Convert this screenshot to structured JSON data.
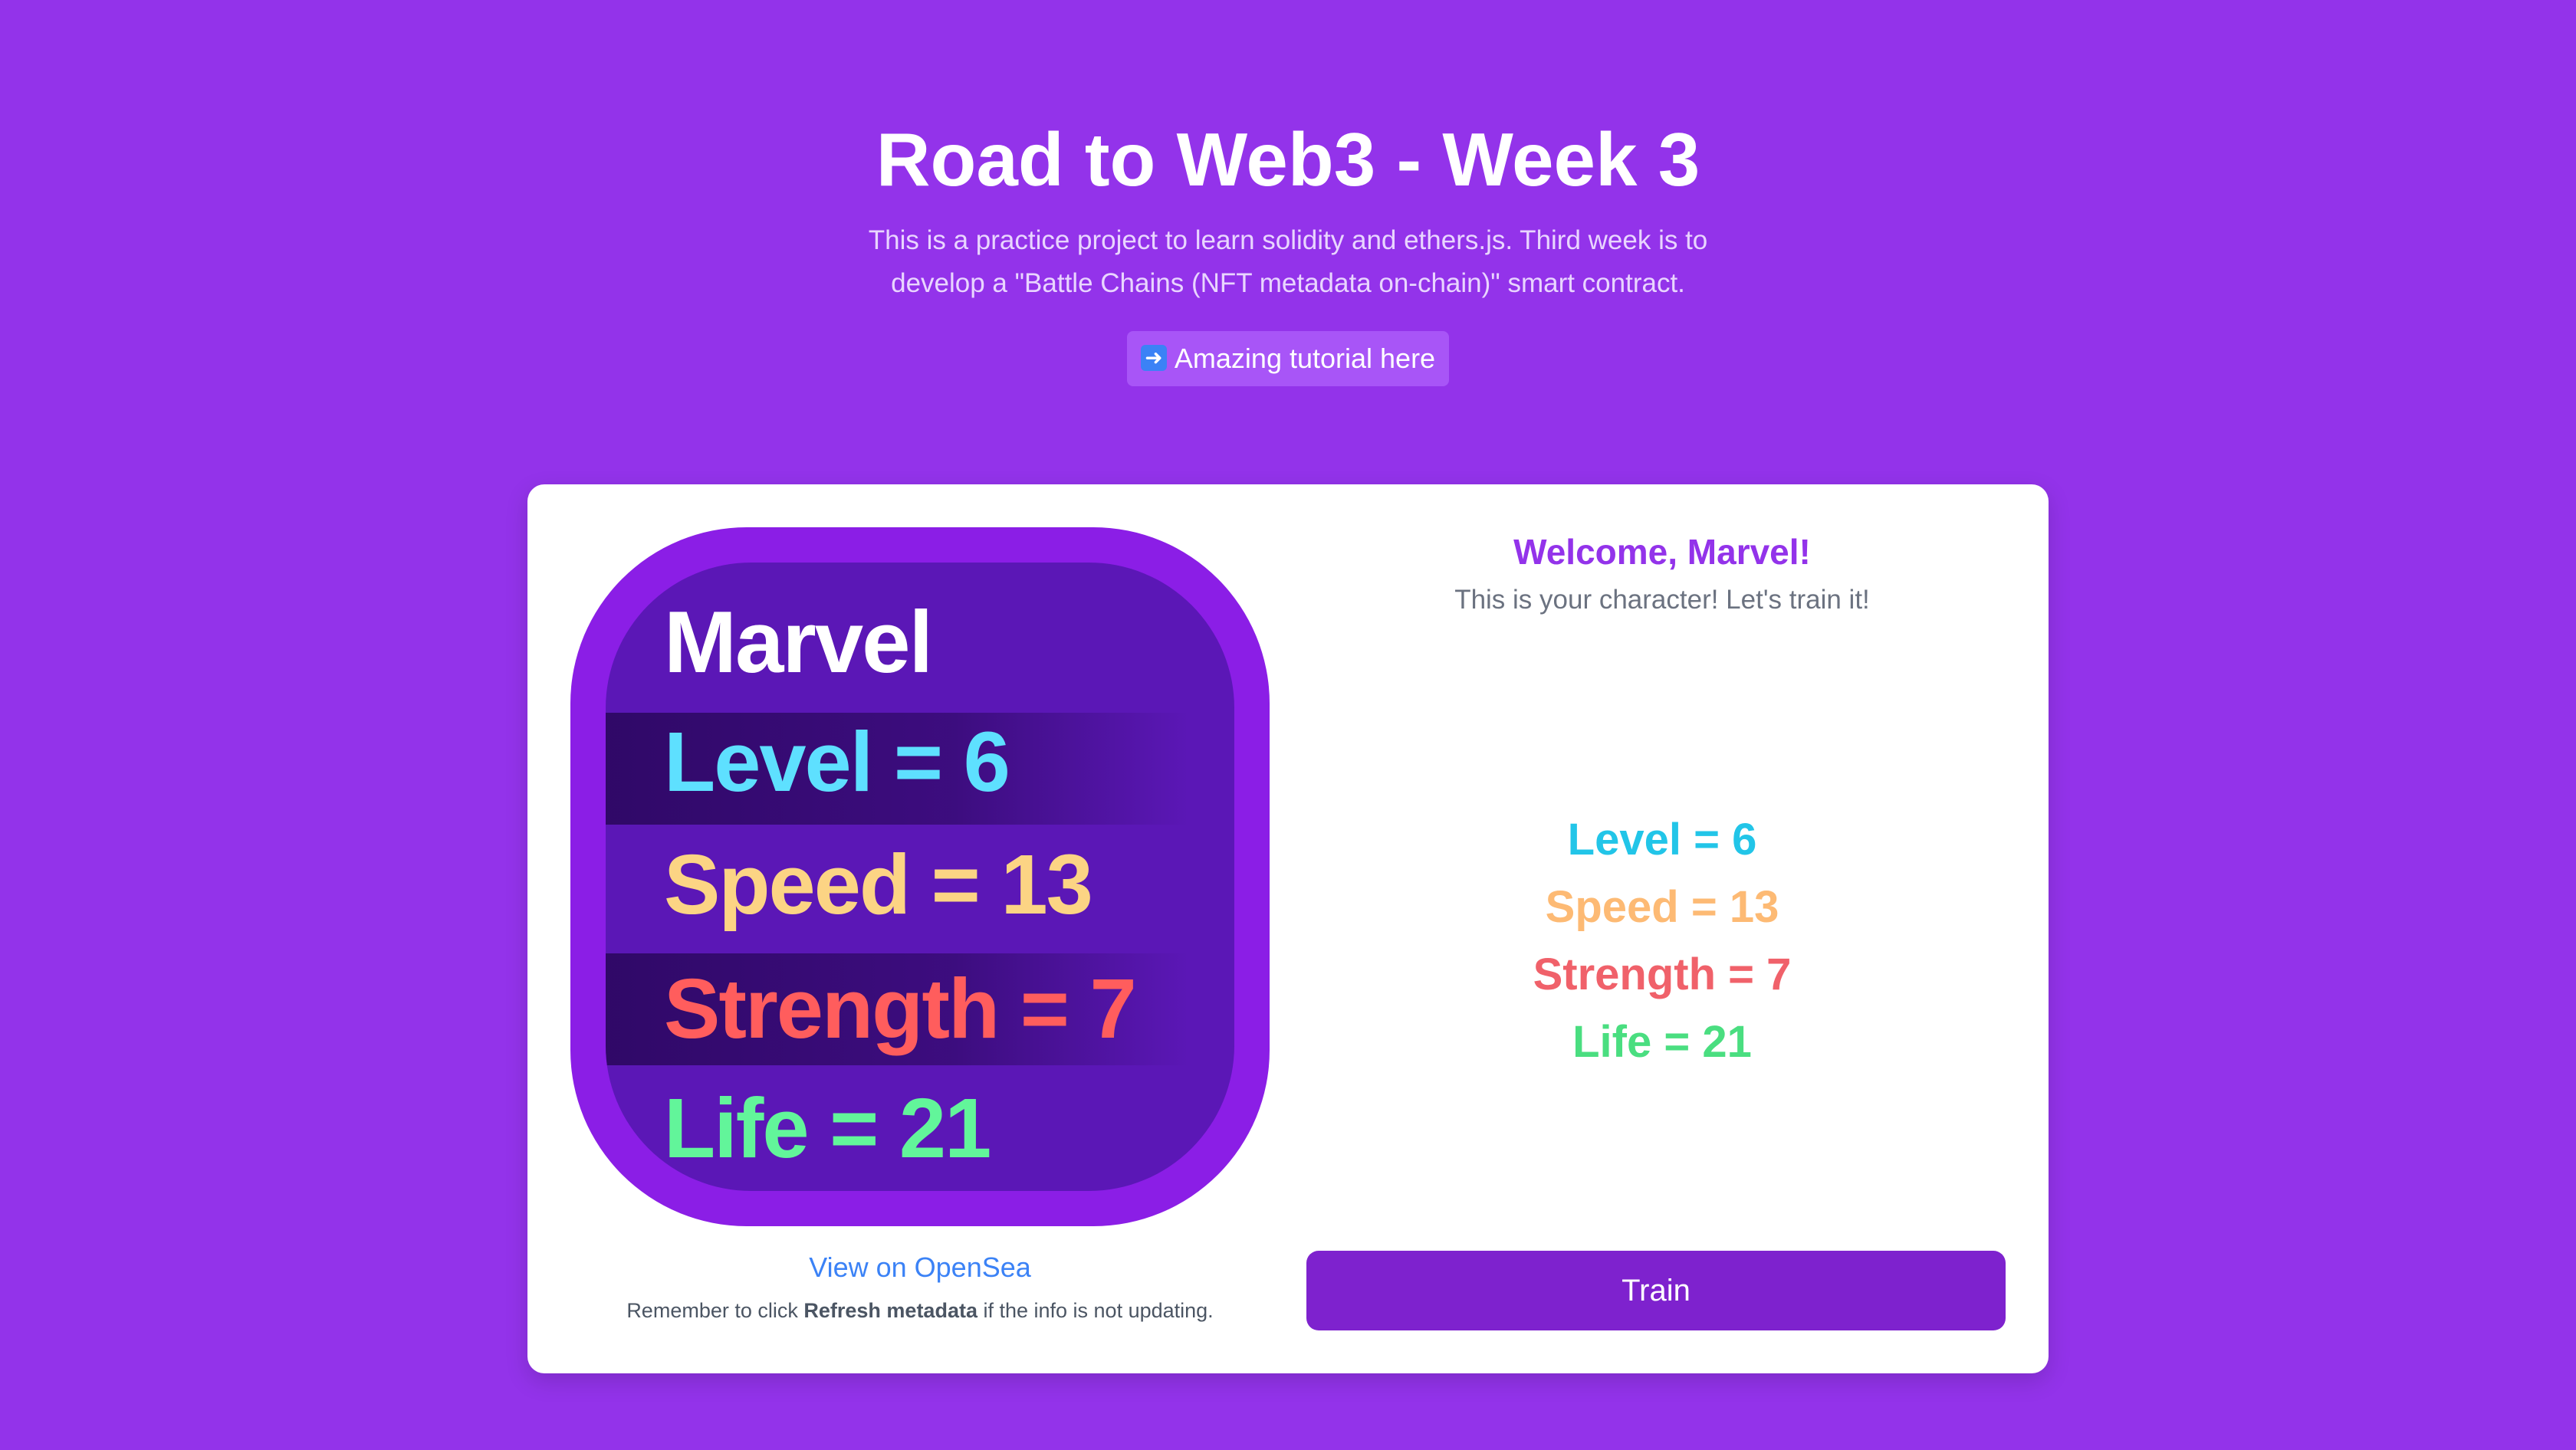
{
  "header": {
    "title": "Road to Web3 - Week 3",
    "subtitle": "This is a practice project to learn solidity and ethers.js. Third week is to develop a \"Battle Chains (NFT metadata on-chain)\" smart contract.",
    "tutorial_link": "Amazing tutorial here",
    "tutorial_icon": "arrow-right-icon"
  },
  "nft": {
    "name": "Marvel",
    "level": "Level = 6",
    "speed": "Speed = 13",
    "strength": "Strength = 7",
    "life": "Life = 21"
  },
  "card": {
    "opensea_link": "View on OpenSea",
    "refresh_prefix": "Remember to click ",
    "refresh_bold": "Refresh metadata",
    "refresh_suffix": " if the info is not updating.",
    "welcome": "Welcome, Marvel!",
    "welcome_sub": "This is your character! Let's train it!",
    "stats": {
      "level": "Level = 6",
      "speed": "Speed = 13",
      "strength": "Strength = 7",
      "life": "Life = 21"
    },
    "train_button": "Train"
  },
  "colors": {
    "background": "#9333ea",
    "accent": "#7e22ce",
    "level": "#22c5e8",
    "speed": "#fdba74",
    "strength": "#f0616a",
    "life": "#4ade80"
  }
}
